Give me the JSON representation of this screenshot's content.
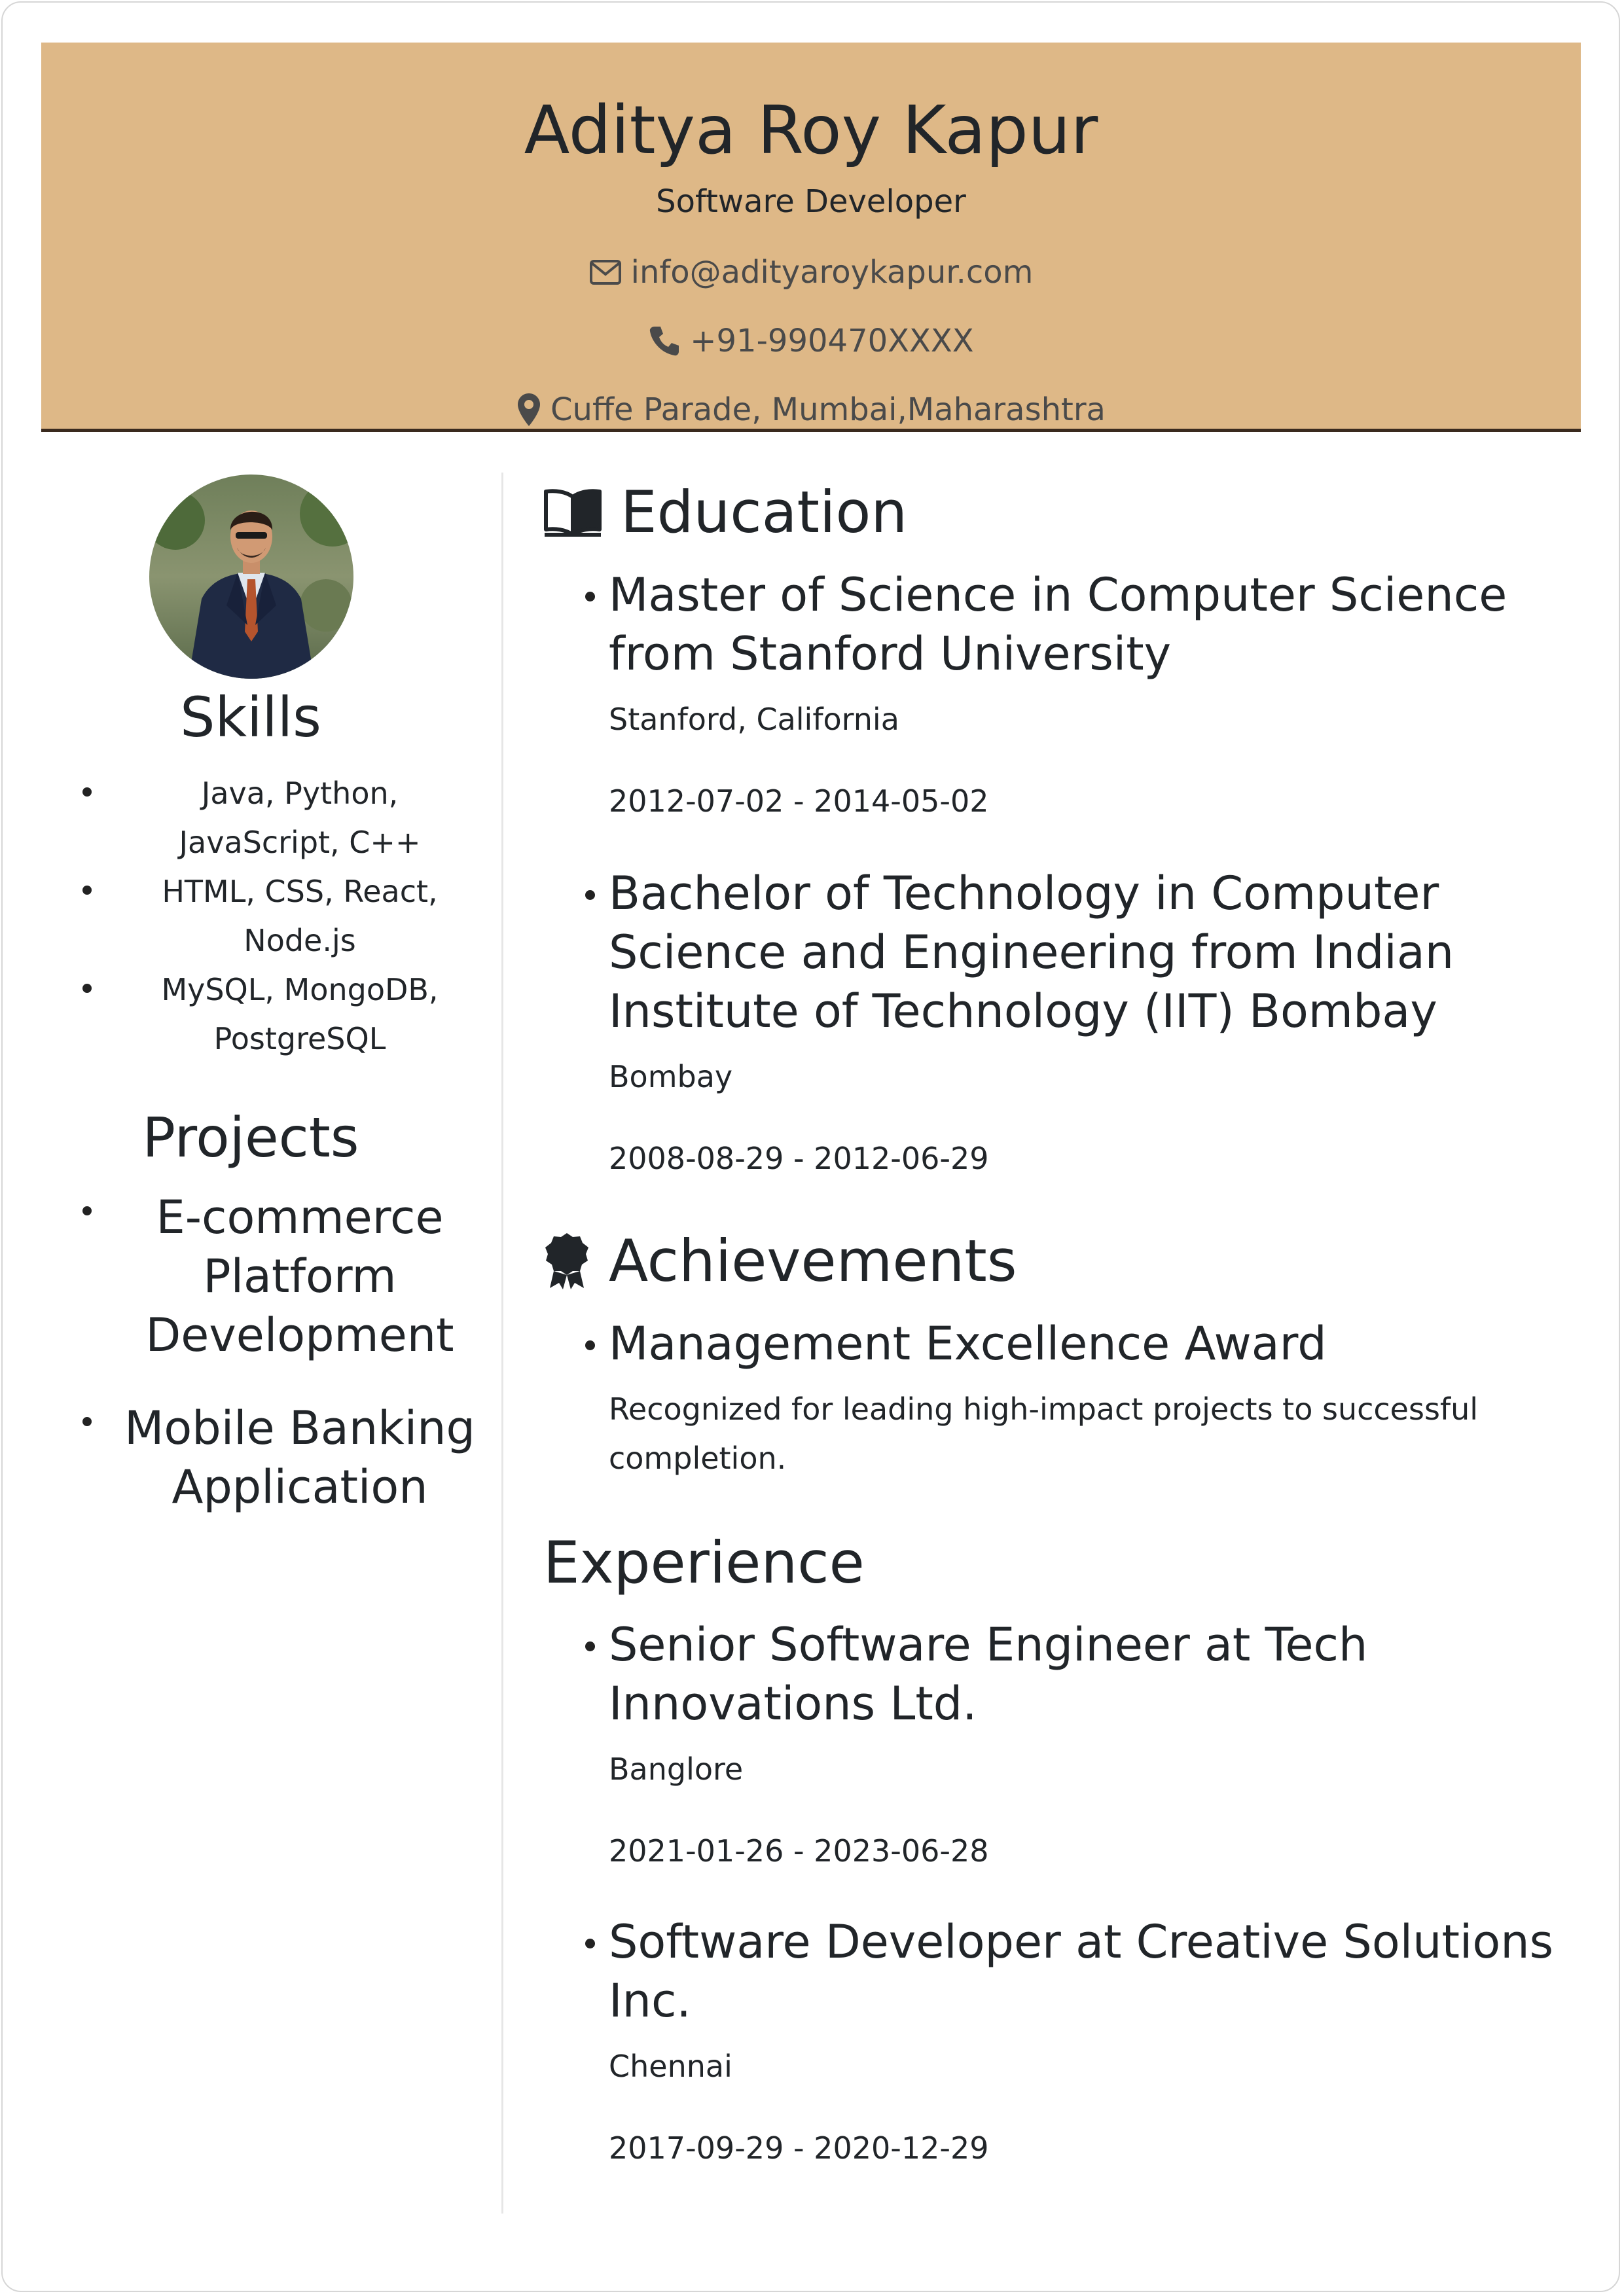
{
  "header": {
    "name": "Aditya Roy Kapur",
    "title": "Software Developer",
    "email": "info@adityaroykapur.com",
    "phone": "+91-990470XXXX",
    "location": "Cuffe Parade, Mumbai,Maharashtra",
    "background_color": "#deb887"
  },
  "sidebar": {
    "skills_heading": "Skills",
    "skills": [
      "Java, Python, JavaScript, C++",
      "HTML, CSS, React, Node.js",
      "MySQL, MongoDB, PostgreSQL"
    ],
    "projects_heading": "Projects",
    "projects": [
      "E-commerce Platform Development",
      "Mobile Banking Application"
    ]
  },
  "education": {
    "heading": "Education",
    "icon": "book-icon",
    "items": [
      {
        "title": "Master of Science in Computer Science from Stanford University",
        "location": "Stanford, California",
        "dates": "2012-07-02 - 2014-05-02"
      },
      {
        "title": "Bachelor of Technology in Computer Science and Engineering from Indian Institute of Technology (IIT) Bombay",
        "location": "Bombay",
        "dates": "2008-08-29 - 2012-06-29"
      }
    ]
  },
  "achievements": {
    "heading": "Achievements",
    "icon": "award-icon",
    "items": [
      {
        "title": "Management Excellence Award",
        "description": "Recognized for leading high-impact projects to successful completion."
      }
    ]
  },
  "experience": {
    "heading": "Experience",
    "items": [
      {
        "title": "Senior Software Engineer at Tech Innovations Ltd.",
        "location": "Banglore",
        "dates": "2021-01-26 - 2023-06-28"
      },
      {
        "title": "Software Developer at Creative Solutions Inc.",
        "location": "Chennai",
        "dates": "2017-09-29 - 2020-12-29"
      }
    ]
  }
}
